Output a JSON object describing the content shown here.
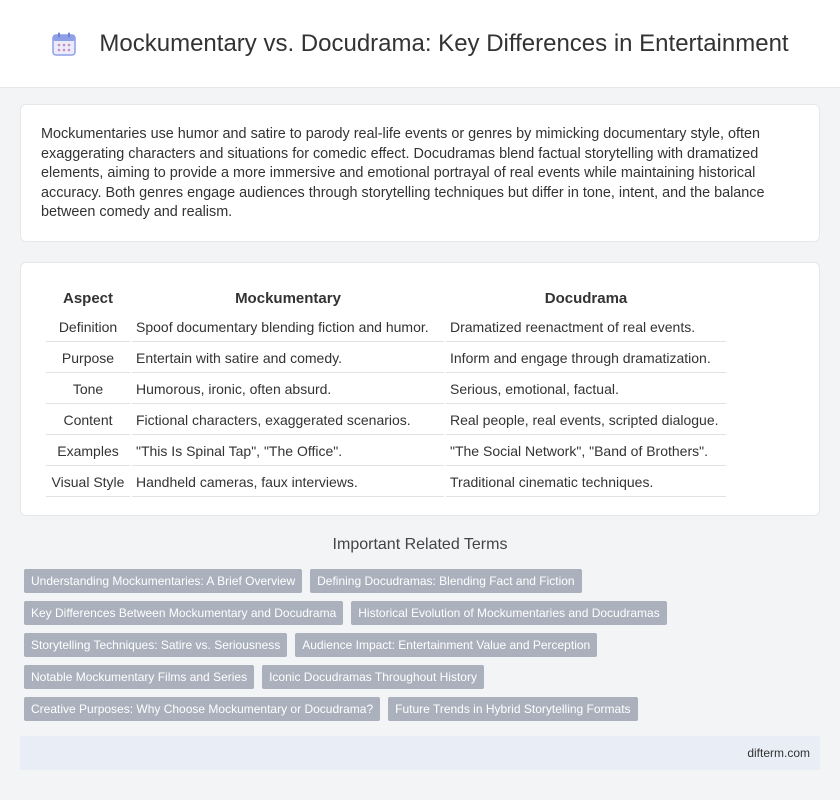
{
  "header": {
    "title": "Mockumentary vs. Docudrama: Key Differences in Entertainment",
    "logo_icon": "calendar-icon"
  },
  "intro": {
    "text": "Mockumentaries use humor and satire to parody real-life events or genres by mimicking documentary style, often exaggerating characters and situations for comedic effect. Docudramas blend factual storytelling with dramatized elements, aiming to provide a more immersive and emotional portrayal of real events while maintaining historical accuracy. Both genres engage audiences through storytelling techniques but differ in tone, intent, and the balance between comedy and realism."
  },
  "table": {
    "headers": [
      "Aspect",
      "Mockumentary",
      "Docudrama"
    ],
    "rows": [
      [
        "Definition",
        "Spoof documentary blending fiction and humor.",
        "Dramatized reenactment of real events."
      ],
      [
        "Purpose",
        "Entertain with satire and comedy.",
        "Inform and engage through dramatization."
      ],
      [
        "Tone",
        "Humorous, ironic, often absurd.",
        "Serious, emotional, factual."
      ],
      [
        "Content",
        "Fictional characters, exaggerated scenarios.",
        "Real people, real events, scripted dialogue."
      ],
      [
        "Examples",
        "\"This Is Spinal Tap\", \"The Office\".",
        "\"The Social Network\", \"Band of Brothers\"."
      ],
      [
        "Visual Style",
        "Handheld cameras, faux interviews.",
        "Traditional cinematic techniques."
      ]
    ]
  },
  "related": {
    "title": "Important Related Terms",
    "rows": [
      [
        "Understanding Mockumentaries: A Brief Overview",
        "Defining Docudramas: Blending Fact and Fiction"
      ],
      [
        "Key Differences Between Mockumentary and Docudrama",
        "Historical Evolution of Mockumentaries and Docudramas"
      ],
      [
        "Storytelling Techniques: Satire vs. Seriousness",
        "Audience Impact: Entertainment Value and Perception"
      ],
      [
        "Notable Mockumentary Films and Series",
        "Iconic Docudramas Throughout History"
      ],
      [
        "Creative Purposes: Why Choose Mockumentary or Docudrama?",
        "Future Trends in Hybrid Storytelling Formats"
      ]
    ]
  },
  "footer": {
    "site": "difterm.com"
  },
  "colors": {
    "tag_bg": "#aab1bd",
    "footer_bg": "#e8edf6",
    "logo_accent": "#7c8fe0"
  }
}
